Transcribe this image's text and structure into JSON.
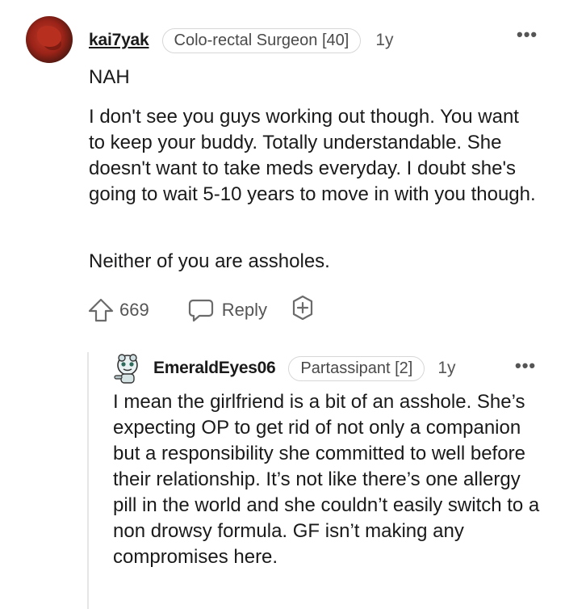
{
  "comment": {
    "username": "kai7yak",
    "flair": "Colo-rectal Surgeon [40]",
    "age": "1y",
    "more": "•••",
    "paragraphs": [
      "NAH",
      "I don't see you guys working out though. You want to keep your buddy. Totally understandable. She doesn't want to take meds everyday. I doubt she's going to wait 5-10 years to move in with you though.",
      "Neither of you are assholes."
    ],
    "votes": "669",
    "reply_label": "Reply"
  },
  "reply_comment": {
    "username": "EmeraldEyes06",
    "flair": "Partassipant [2]",
    "age": "1y",
    "more": "•••",
    "text": "I mean the girlfriend is a bit of an asshole. She’s expecting OP to get rid of not only a companion but a responsibility she committed to well before their relationship. It’s not like there’s one allergy pill in the world and she couldn’t easily switch to a non drowsy formula. GF isn’t making any compromises here."
  },
  "icons": {
    "upvote": "upvote-arrow-icon",
    "reply": "speech-bubble-icon",
    "award": "award-plus-icon",
    "more": "more-dots-icon"
  },
  "colors": {
    "text": "#1a1a1b",
    "meta": "#555555",
    "flair_border": "#d7d7d7",
    "thread_line": "#e6e6e6"
  }
}
